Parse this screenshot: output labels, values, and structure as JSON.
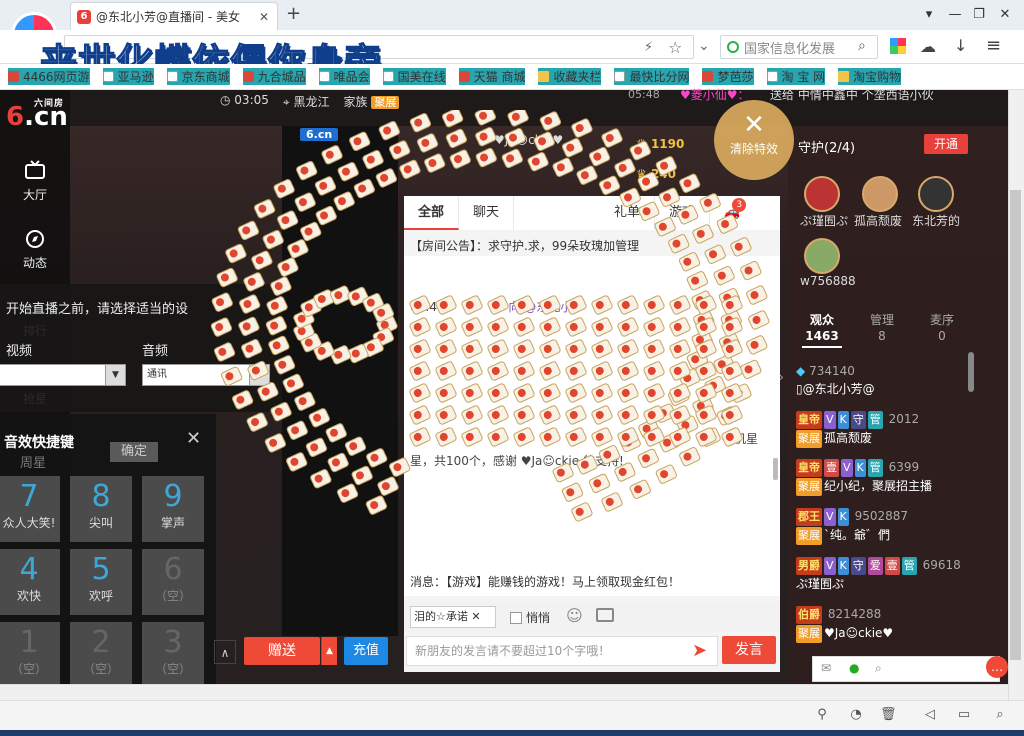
{
  "browser": {
    "tab_title": "@东北小芳@直播间 - 美女",
    "tab_favicon": "6",
    "search_placeholder": "国家信息化发展",
    "overlay_title": "来世化蝶依偎你身旁",
    "bookmarks": [
      {
        "label": "4466网页游",
        "icon": "page"
      },
      {
        "label": "亚马逊",
        "icon": "page"
      },
      {
        "label": "京东商城",
        "icon": "page"
      },
      {
        "label": "九合城品",
        "icon": "page"
      },
      {
        "label": "唯品会",
        "icon": "page"
      },
      {
        "label": "国美在线",
        "icon": "page"
      },
      {
        "label": "天猫 商城",
        "icon": "page"
      },
      {
        "label": "收藏夹栏",
        "icon": "folder"
      },
      {
        "label": "最快比分网",
        "icon": "page"
      },
      {
        "label": "梦芭莎",
        "icon": "page"
      },
      {
        "label": "淘 宝 网",
        "icon": "page"
      },
      {
        "label": "淘宝购物",
        "icon": "folder"
      }
    ]
  },
  "site": {
    "logo_small": "六间房",
    "logo_big": "6.cn"
  },
  "nav": [
    {
      "label": "大厅",
      "icon": "tv-icon"
    },
    {
      "label": "动态",
      "icon": "compass-icon"
    },
    {
      "label": "排行",
      "icon": "crown-icon"
    },
    {
      "label": "抢星",
      "icon": "star-icon"
    }
  ],
  "room": {
    "time": "03:05",
    "location": "黑龙江",
    "family_label": "家族",
    "family_badge": "聚展"
  },
  "settings": {
    "hint": "开始直播之前，请选择适当的设",
    "video_label": "视频",
    "audio_label": "音频",
    "audio_select": "通讯"
  },
  "sfx": {
    "title": "音效快捷键",
    "confirm": "确定",
    "bg_text": "周星",
    "keys": [
      {
        "num": "7",
        "label": "众人大笑!",
        "dim": false
      },
      {
        "num": "8",
        "label": "尖叫",
        "dim": false
      },
      {
        "num": "9",
        "label": "掌声",
        "dim": false
      },
      {
        "num": "4",
        "label": "欢快",
        "dim": false
      },
      {
        "num": "5",
        "label": "欢呼",
        "dim": false
      },
      {
        "num": "6",
        "label": "（空）",
        "dim": true
      },
      {
        "num": "1",
        "label": "（空）",
        "dim": true
      },
      {
        "num": "2",
        "label": "（空）",
        "dim": true
      },
      {
        "num": "3",
        "label": "（空）",
        "dim": true
      }
    ]
  },
  "video": {
    "badge": "6.cn"
  },
  "streamer": {
    "name": "Ja☺ckie",
    "coins1": "1190",
    "coins2": "240"
  },
  "chat": {
    "tabs": [
      "全部",
      "聊天",
      "礼单",
      "游戏"
    ],
    "car_count": "3",
    "announcement": "【房间公告】：求守护.求，99朵玫瑰加管理",
    "msg_time": "05:49",
    "msg_text": "向 @东北小",
    "msg_tail": "手机星",
    "gift_line": "星，共100个，感谢 ♥Ja☺ckie 的支持!",
    "system_msg": "消息：【游戏】能赚钱的游戏！马上领取现金红包！",
    "target": "泪的☆承诺",
    "quiet_label": "悄悄",
    "input_placeholder": "新朋友的发言请不要超过10个字哦！",
    "send": "发言"
  },
  "gift_bar": {
    "gift_button": "赠送",
    "recharge_button": "充值"
  },
  "right": {
    "clear_effects": "清除特效",
    "guard_label": "守护(2/4)",
    "open_button": "开通",
    "guardians": [
      {
        "name": "ぷ瑾囿ぷ"
      },
      {
        "name": "孤高颓废"
      },
      {
        "name": "东北芳的"
      },
      {
        "name": "w756888"
      }
    ],
    "aud_tabs": [
      {
        "label": "观众",
        "count": "1463",
        "active": true
      },
      {
        "label": "管理",
        "count": "8",
        "active": false
      },
      {
        "label": "麦序",
        "count": "0",
        "active": false
      }
    ],
    "users": [
      {
        "id": "734140",
        "name": "@东北小芳@"
      },
      {
        "rank": "皇帝",
        "id": "2012",
        "family": "聚展",
        "name": "孤高颓废"
      },
      {
        "rank": "皇帝",
        "id": "6399",
        "family": "聚展",
        "name": "纪小纪，聚展招主播"
      },
      {
        "rank": "郡王",
        "id": "9502887",
        "family": "聚展",
        "name": "`纯。爺゛們"
      },
      {
        "rank": "男爵",
        "id": "69618",
        "name": "ぷ瑾囿ぷ"
      },
      {
        "rank": "伯爵",
        "id": "8214288",
        "family": "聚展",
        "name": "♥Ja☺ckie♥"
      }
    ]
  },
  "top": {
    "time": "05:48",
    "text1": "♥菱小仙♥：",
    "text2": "送给 中情中鑫中 个垄西语小伙"
  }
}
